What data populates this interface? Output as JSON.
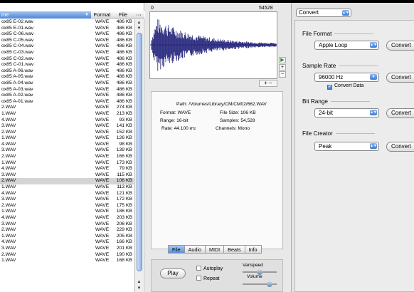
{
  "file_list": {
    "headers": {
      "name": "me",
      "format": "Format",
      "size": "File",
      "more": "⋯"
    },
    "rows": [
      {
        "name": "ox85 E-02.wav",
        "format": "WAVE",
        "size": "486 KB"
      },
      {
        "name": "ox85 E-01.wav",
        "format": "WAVE",
        "size": "486 KB"
      },
      {
        "name": "ox85 C-06.wav",
        "format": "WAVE",
        "size": "486 KB"
      },
      {
        "name": "ox85 C-05.wav",
        "format": "WAVE",
        "size": "486 KB"
      },
      {
        "name": "ox85 C-04.wav",
        "format": "WAVE",
        "size": "486 KB"
      },
      {
        "name": "ox85 C-03.wav",
        "format": "WAVE",
        "size": "486 KB"
      },
      {
        "name": "ox85 C-02.wav",
        "format": "WAVE",
        "size": "486 KB"
      },
      {
        "name": "ox85 C-01.wav",
        "format": "WAVE",
        "size": "486 KB"
      },
      {
        "name": "ox85 A-06.wav",
        "format": "WAVE",
        "size": "486 KB"
      },
      {
        "name": "ox85 A-05.wav",
        "format": "WAVE",
        "size": "486 KB"
      },
      {
        "name": "ox85 A-04.wav",
        "format": "WAVE",
        "size": "486 KB"
      },
      {
        "name": "ox85 A-03.wav",
        "format": "WAVE",
        "size": "486 KB"
      },
      {
        "name": "ox85 A-02.wav",
        "format": "WAVE",
        "size": "486 KB"
      },
      {
        "name": "ox85 A-01.wav",
        "format": "WAVE",
        "size": "486 KB"
      },
      {
        "name": "2.WAV",
        "format": "WAVE",
        "size": "274 KB"
      },
      {
        "name": "1.WAV",
        "format": "WAVE",
        "size": "213 KB"
      },
      {
        "name": "4.WAV",
        "format": "WAVE",
        "size": "93 KB"
      },
      {
        "name": "3.WAV",
        "format": "WAVE",
        "size": "141 KB"
      },
      {
        "name": "2.WAV",
        "format": "WAVE",
        "size": "152 KB"
      },
      {
        "name": "1.WAV",
        "format": "WAVE",
        "size": "126 KB"
      },
      {
        "name": "4.WAV",
        "format": "WAVE",
        "size": "98 KB"
      },
      {
        "name": "3.WAV",
        "format": "WAVE",
        "size": "139 KB"
      },
      {
        "name": "2.WAV",
        "format": "WAVE",
        "size": "166 KB"
      },
      {
        "name": "1.WAV",
        "format": "WAVE",
        "size": "173 KB"
      },
      {
        "name": "4.WAV",
        "format": "WAVE",
        "size": "79 KB"
      },
      {
        "name": "3.WAV",
        "format": "WAVE",
        "size": "115 KB"
      },
      {
        "name": "2.WAV",
        "format": "WAVE",
        "size": "106 KB",
        "selected": true
      },
      {
        "name": "1.WAV",
        "format": "WAVE",
        "size": "113 KB"
      },
      {
        "name": "4.WAV",
        "format": "WAVE",
        "size": "121 KB"
      },
      {
        "name": "3.WAV",
        "format": "WAVE",
        "size": "172 KB"
      },
      {
        "name": "2.WAV",
        "format": "WAVE",
        "size": "175 KB"
      },
      {
        "name": "1.WAV",
        "format": "WAVE",
        "size": "186 KB"
      },
      {
        "name": "4.WAV",
        "format": "WAVE",
        "size": "203 KB"
      },
      {
        "name": "3.WAV",
        "format": "WAVE",
        "size": "206 KB"
      },
      {
        "name": "2.WAV",
        "format": "WAVE",
        "size": "229 KB"
      },
      {
        "name": "1.WAV",
        "format": "WAVE",
        "size": "205 KB"
      },
      {
        "name": "4.WAV",
        "format": "WAVE",
        "size": "166 KB"
      },
      {
        "name": "3.WAV",
        "format": "WAVE",
        "size": "201 KB"
      },
      {
        "name": "2.WAV",
        "format": "WAVE",
        "size": "190 KB"
      },
      {
        "name": "1.WAV",
        "format": "WAVE",
        "size": "168 KB"
      }
    ]
  },
  "waveform": {
    "start_label": "0",
    "end_label": "54528"
  },
  "info": {
    "path_label": "Path:",
    "path": "/Volumes/Library/CM/CM02/662.WAV",
    "format_label": "Format:",
    "format": "WAVE",
    "file_size_label": "File Size:",
    "file_size": "106 KB",
    "range_label": "Range:",
    "range": "16-bit",
    "samples_label": "Samples:",
    "samples": "54,528",
    "rate_label": "Rate:",
    "rate": "44.100",
    "rate_unit": "kHz",
    "channels_label": "Channels:",
    "channels": "Mono"
  },
  "tabs": [
    "File",
    "Audio",
    "MIDI",
    "Beats",
    "Info"
  ],
  "playback": {
    "play": "Play",
    "autoplay": "Autoplay",
    "repeat": "Repeat",
    "varispeed": "Varispeed",
    "volume": "Volume"
  },
  "converter": {
    "mode": "Convert",
    "file_format": {
      "title": "File Format",
      "value": "Apple Loop",
      "button": "Convert"
    },
    "sample_rate": {
      "title": "Sample Rate",
      "value": "96000 Hz",
      "button": "Convert",
      "checkbox": "Convert Data"
    },
    "bit_range": {
      "title": "Bit Range",
      "value": "24-bit",
      "button": "Convert"
    },
    "file_creator": {
      "title": "File Creator",
      "value": "Peak",
      "button": "Convert"
    }
  }
}
